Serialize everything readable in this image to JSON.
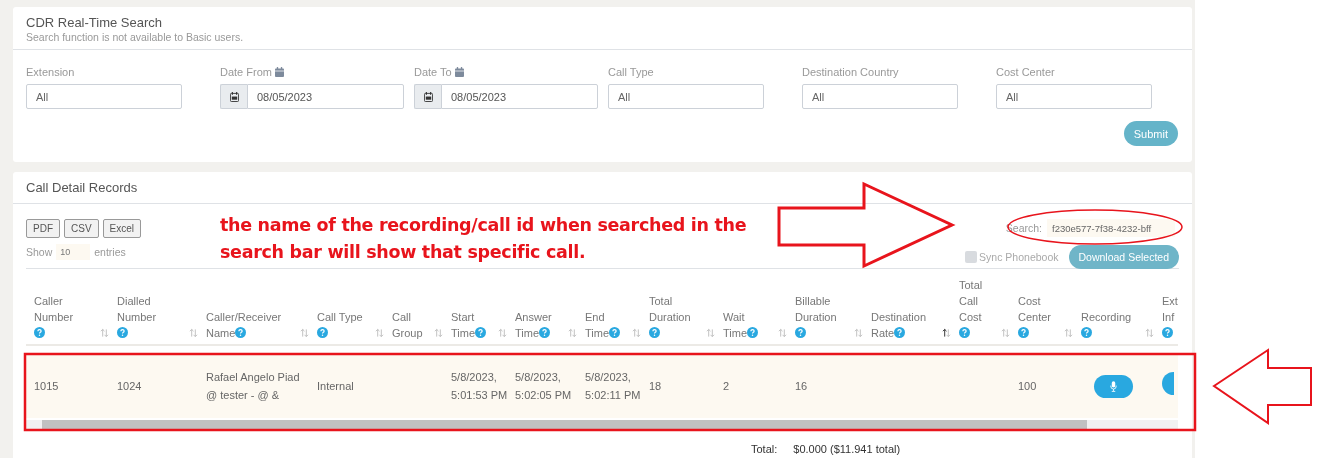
{
  "search_panel": {
    "title": "CDR Real-Time Search",
    "subtitle": "Search function is not available to Basic users.",
    "filters": [
      {
        "label": "Extension",
        "value": "All",
        "kind": "text"
      },
      {
        "label": "Date From",
        "value": "08/05/2023",
        "kind": "date"
      },
      {
        "label": "Date To",
        "value": "08/05/2023",
        "kind": "date"
      },
      {
        "label": "Call Type",
        "value": "All",
        "kind": "text"
      },
      {
        "label": "Destination Country",
        "value": "All",
        "kind": "text"
      },
      {
        "label": "Cost Center",
        "value": "All",
        "kind": "text"
      }
    ],
    "submit": "Submit"
  },
  "records": {
    "title": "Call Detail Records",
    "export_buttons": [
      "PDF",
      "CSV",
      "Excel"
    ],
    "show_label": "Show",
    "page_size": "10",
    "entries_label": "entries",
    "search_label": "Search:",
    "search_value": "f230e577-7f38-4232-bff",
    "sync_phonebook": {
      "label": "Sync Phonebook",
      "checked": false
    },
    "download": {
      "label": "Download Selected",
      "disabled": true
    },
    "columns": [
      {
        "label": "Caller Number",
        "help": true,
        "sorted": false,
        "kind": "text"
      },
      {
        "label": "Dialled Number",
        "help": true,
        "sorted": false,
        "kind": "text"
      },
      {
        "label": "Caller/Receiver Name",
        "help": true,
        "sorted": false,
        "kind": "text"
      },
      {
        "label": "Call Type",
        "help": true,
        "sorted": false,
        "kind": "text"
      },
      {
        "label": "Call Group",
        "help": false,
        "sorted": false,
        "kind": "text"
      },
      {
        "label": "Start Time",
        "help": true,
        "sorted": false,
        "kind": "text"
      },
      {
        "label": "Answer Time",
        "help": true,
        "sorted": false,
        "kind": "text"
      },
      {
        "label": "End Time",
        "help": true,
        "sorted": false,
        "kind": "text"
      },
      {
        "label": "Total Duration",
        "help": true,
        "sorted": false,
        "kind": "text"
      },
      {
        "label": "Wait Time",
        "help": true,
        "sorted": false,
        "kind": "text"
      },
      {
        "label": "Billable Duration",
        "help": true,
        "sorted": false,
        "kind": "text"
      },
      {
        "label": "Destination Rate",
        "help": true,
        "sorted": true,
        "kind": "text"
      },
      {
        "label": "Total Call Cost",
        "help": true,
        "sorted": false,
        "kind": "text"
      },
      {
        "label": "Cost Center",
        "help": true,
        "sorted": false,
        "kind": "text"
      },
      {
        "label": "Recording",
        "help": true,
        "sorted": false,
        "kind": "mic_button"
      },
      {
        "label": "Ext Inf",
        "help": true,
        "kind": "cut_button"
      }
    ],
    "rows": [
      {
        "cells": {
          "0": "1015",
          "1": "1024",
          "2": "Rafael Angelo Piad @ tester - @ &",
          "3": "Internal",
          "5": "5/8/2023, 5:01:53 PM",
          "6": "5/8/2023, 5:02:05 PM",
          "7": "5/8/2023, 5:02:11 PM",
          "8": "18",
          "9": "2",
          "10": "16",
          "13": "100"
        }
      }
    ],
    "total_label": "Total:",
    "total_value": "$0.000 ($11.941 total)"
  },
  "annotation": {
    "text": "the name of the recording/call id when searched in the search bar will show that specific call."
  }
}
